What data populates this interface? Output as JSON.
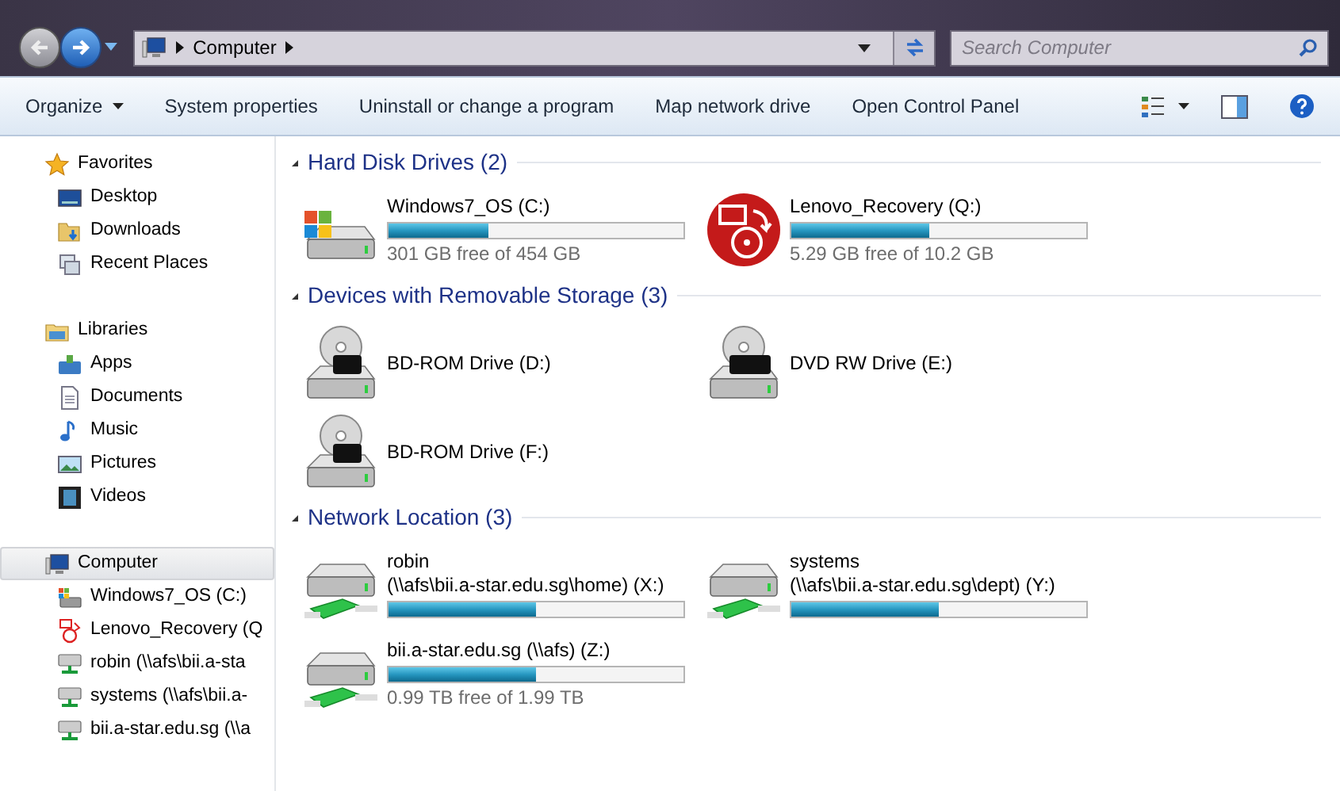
{
  "address_bar": {
    "crumbs": [
      "Computer"
    ]
  },
  "search": {
    "placeholder": "Search Computer"
  },
  "toolbar": {
    "items": [
      {
        "label": "Organize",
        "kind": "menu"
      },
      {
        "label": "System properties",
        "kind": "button"
      },
      {
        "label": "Uninstall or change a program",
        "kind": "button"
      },
      {
        "label": "Map network drive",
        "kind": "button"
      },
      {
        "label": "Open Control Panel",
        "kind": "button"
      }
    ]
  },
  "nav": {
    "groups": [
      {
        "label": "Favorites",
        "kind": "star",
        "selected": false,
        "children": [
          {
            "label": "Desktop",
            "kind": "desktop",
            "selected": false
          },
          {
            "label": "Downloads",
            "kind": "folder",
            "selected": false
          },
          {
            "label": "Recent Places",
            "kind": "recent",
            "selected": false
          }
        ]
      },
      {
        "label": "Libraries",
        "kind": "library",
        "selected": false,
        "children": [
          {
            "label": "Apps",
            "kind": "apps",
            "selected": false
          },
          {
            "label": "Documents",
            "kind": "document",
            "selected": false
          },
          {
            "label": "Music",
            "kind": "music",
            "selected": false
          },
          {
            "label": "Pictures",
            "kind": "picture",
            "selected": false
          },
          {
            "label": "Videos",
            "kind": "video",
            "selected": false
          }
        ]
      },
      {
        "label": "Computer",
        "kind": "computer",
        "selected": true,
        "children": [
          {
            "label": "Windows7_OS (C:)",
            "kind": "windisk",
            "selected": false
          },
          {
            "label": "Lenovo_Recovery (Q",
            "kind": "recovery",
            "selected": false
          },
          {
            "label": "robin (\\\\afs\\bii.a-sta",
            "kind": "network",
            "selected": false
          },
          {
            "label": "systems (\\\\afs\\bii.a-",
            "kind": "network",
            "selected": false
          },
          {
            "label": "bii.a-star.edu.sg (\\\\a",
            "kind": "network",
            "selected": false
          }
        ]
      }
    ]
  },
  "sections": [
    {
      "title": "Hard Disk Drives (2)",
      "items": [
        {
          "kind": "windisk",
          "name_lines": [
            "Windows7_OS (C:)"
          ],
          "level": 0.34,
          "free": "301 GB free of 454 GB"
        },
        {
          "kind": "recovery",
          "name_lines": [
            "Lenovo_Recovery (Q:)"
          ],
          "level": 0.47,
          "free": "5.29 GB free of 10.2 GB"
        }
      ]
    },
    {
      "title": "Devices with Removable Storage (3)",
      "items": [
        {
          "kind": "bd",
          "name_lines": [
            "BD-ROM Drive (D:)"
          ]
        },
        {
          "kind": "dvd",
          "name_lines": [
            "DVD RW Drive (E:)"
          ]
        },
        {
          "kind": "bd",
          "name_lines": [
            "BD-ROM Drive (F:)"
          ]
        }
      ]
    },
    {
      "title": "Network Location (3)",
      "items": [
        {
          "kind": "network",
          "name_lines": [
            "robin",
            "(\\\\afs\\bii.a-star.edu.sg\\home) (X:)"
          ],
          "level": 0.5
        },
        {
          "kind": "network",
          "name_lines": [
            "systems",
            "(\\\\afs\\bii.a-star.edu.sg\\dept) (Y:)"
          ],
          "level": 0.5
        },
        {
          "kind": "network",
          "name_lines": [
            "bii.a-star.edu.sg (\\\\afs) (Z:)"
          ],
          "level": 0.5,
          "free": "0.99 TB free of 1.99 TB"
        }
      ]
    }
  ]
}
